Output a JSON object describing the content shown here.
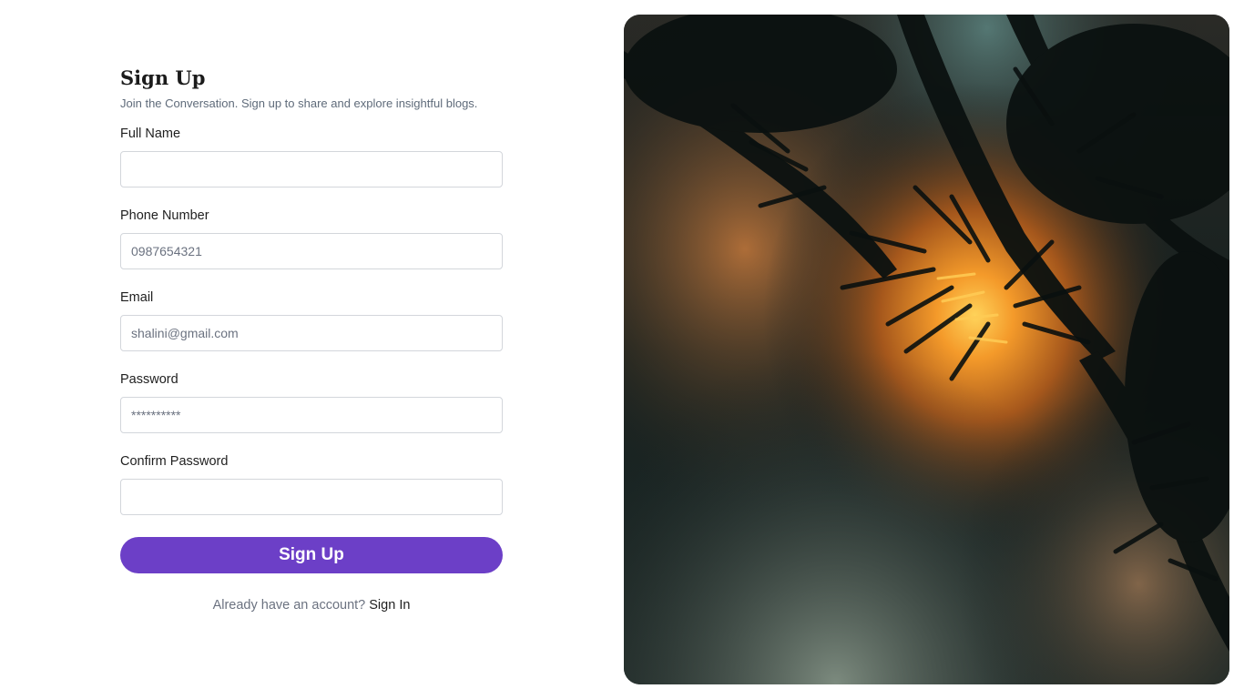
{
  "signup": {
    "title": "Sign Up",
    "subtitle": "Join the Conversation. Sign up to share and explore insightful blogs.",
    "fields": [
      {
        "label": "Full Name",
        "placeholder": "",
        "type": "text"
      },
      {
        "label": "Phone Number",
        "placeholder": "0987654321",
        "type": "text"
      },
      {
        "label": "Email",
        "placeholder": "shalini@gmail.com",
        "type": "email"
      },
      {
        "label": "Password",
        "placeholder": "**********",
        "type": "password"
      },
      {
        "label": "Confirm Password",
        "placeholder": "",
        "type": "password"
      }
    ],
    "submit_label": "Sign Up",
    "signin_prompt": "Already have an account?",
    "signin_link": "Sign In"
  },
  "colors": {
    "accent": "#6c3fc7",
    "background": "#ffffff",
    "text_primary": "#1f1f1f",
    "text_muted": "#6b7280",
    "input_border": "#d3d6db"
  },
  "illustration": {
    "subject": "backlit-pine-branches-at-sunset"
  }
}
